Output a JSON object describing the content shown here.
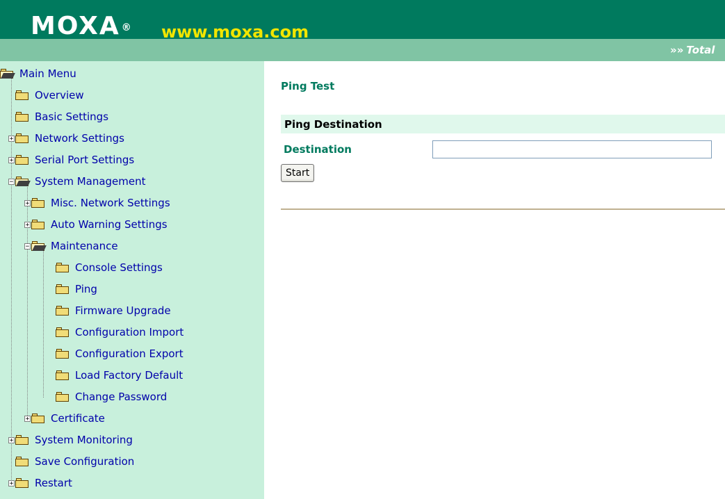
{
  "header": {
    "logo": "MOXA",
    "logo_mark": "®",
    "website": "www.moxa.com",
    "tagline_arrows": "»»",
    "tagline": "Total",
    "colors": {
      "header_bg": "#007a5e",
      "header_bar": "#80c4a4",
      "website": "#f2e500"
    }
  },
  "sidebar": {
    "items": [
      {
        "label": "Main Menu",
        "expander": "",
        "open": true
      },
      {
        "label": "Overview",
        "expander": ""
      },
      {
        "label": "Basic Settings",
        "expander": ""
      },
      {
        "label": "Network Settings",
        "expander": "+"
      },
      {
        "label": "Serial Port Settings",
        "expander": "+"
      },
      {
        "label": "System Management",
        "expander": "−",
        "open": true
      },
      {
        "label": "Misc. Network Settings",
        "expander": "+"
      },
      {
        "label": "Auto Warning Settings",
        "expander": "+"
      },
      {
        "label": "Maintenance",
        "expander": "−",
        "open": true
      },
      {
        "label": "Console Settings",
        "expander": ""
      },
      {
        "label": "Ping",
        "expander": ""
      },
      {
        "label": "Firmware Upgrade",
        "expander": ""
      },
      {
        "label": "Configuration Import",
        "expander": ""
      },
      {
        "label": "Configuration Export",
        "expander": ""
      },
      {
        "label": "Load Factory Default",
        "expander": ""
      },
      {
        "label": "Change Password",
        "expander": ""
      },
      {
        "label": "Certificate",
        "expander": "+"
      },
      {
        "label": "System Monitoring",
        "expander": "+"
      },
      {
        "label": "Save Configuration",
        "expander": ""
      },
      {
        "label": "Restart",
        "expander": "+"
      }
    ]
  },
  "main": {
    "title": "Ping Test",
    "section_title": "Ping Destination",
    "destination_label": "Destination",
    "destination_value": "",
    "start_label": "Start"
  }
}
